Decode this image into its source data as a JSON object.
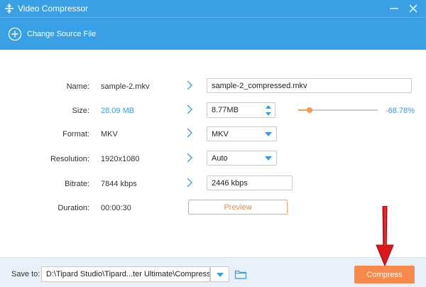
{
  "window": {
    "title": "Video Compressor"
  },
  "toolbar": {
    "change_source_label": "Change Source File"
  },
  "form": {
    "name": {
      "label": "Name:",
      "value": "sample-2.mkv",
      "output": "sample-2_compressed.mkv"
    },
    "size": {
      "label": "Size:",
      "value": "28.09 MB",
      "output": "8.77MB",
      "percent": "-68.78%",
      "slider_fraction": 0.14
    },
    "format": {
      "label": "Format:",
      "value": "MKV",
      "output": "MKV"
    },
    "resolution": {
      "label": "Resolution:",
      "value": "1920x1080",
      "output": "Auto"
    },
    "bitrate": {
      "label": "Bitrate:",
      "value": "7844 kbps",
      "output": "2446 kbps"
    },
    "duration": {
      "label": "Duration:",
      "value": "00:00:30",
      "preview_label": "Preview"
    }
  },
  "footer": {
    "save_label": "Save to:",
    "path": "D:\\Tipard Studio\\Tipard...ter Ultimate\\Compressed",
    "compress_label": "Compress"
  },
  "colors": {
    "accent": "#3aa0e6",
    "orange": "#f8894a",
    "annotation": "#e0141b"
  }
}
